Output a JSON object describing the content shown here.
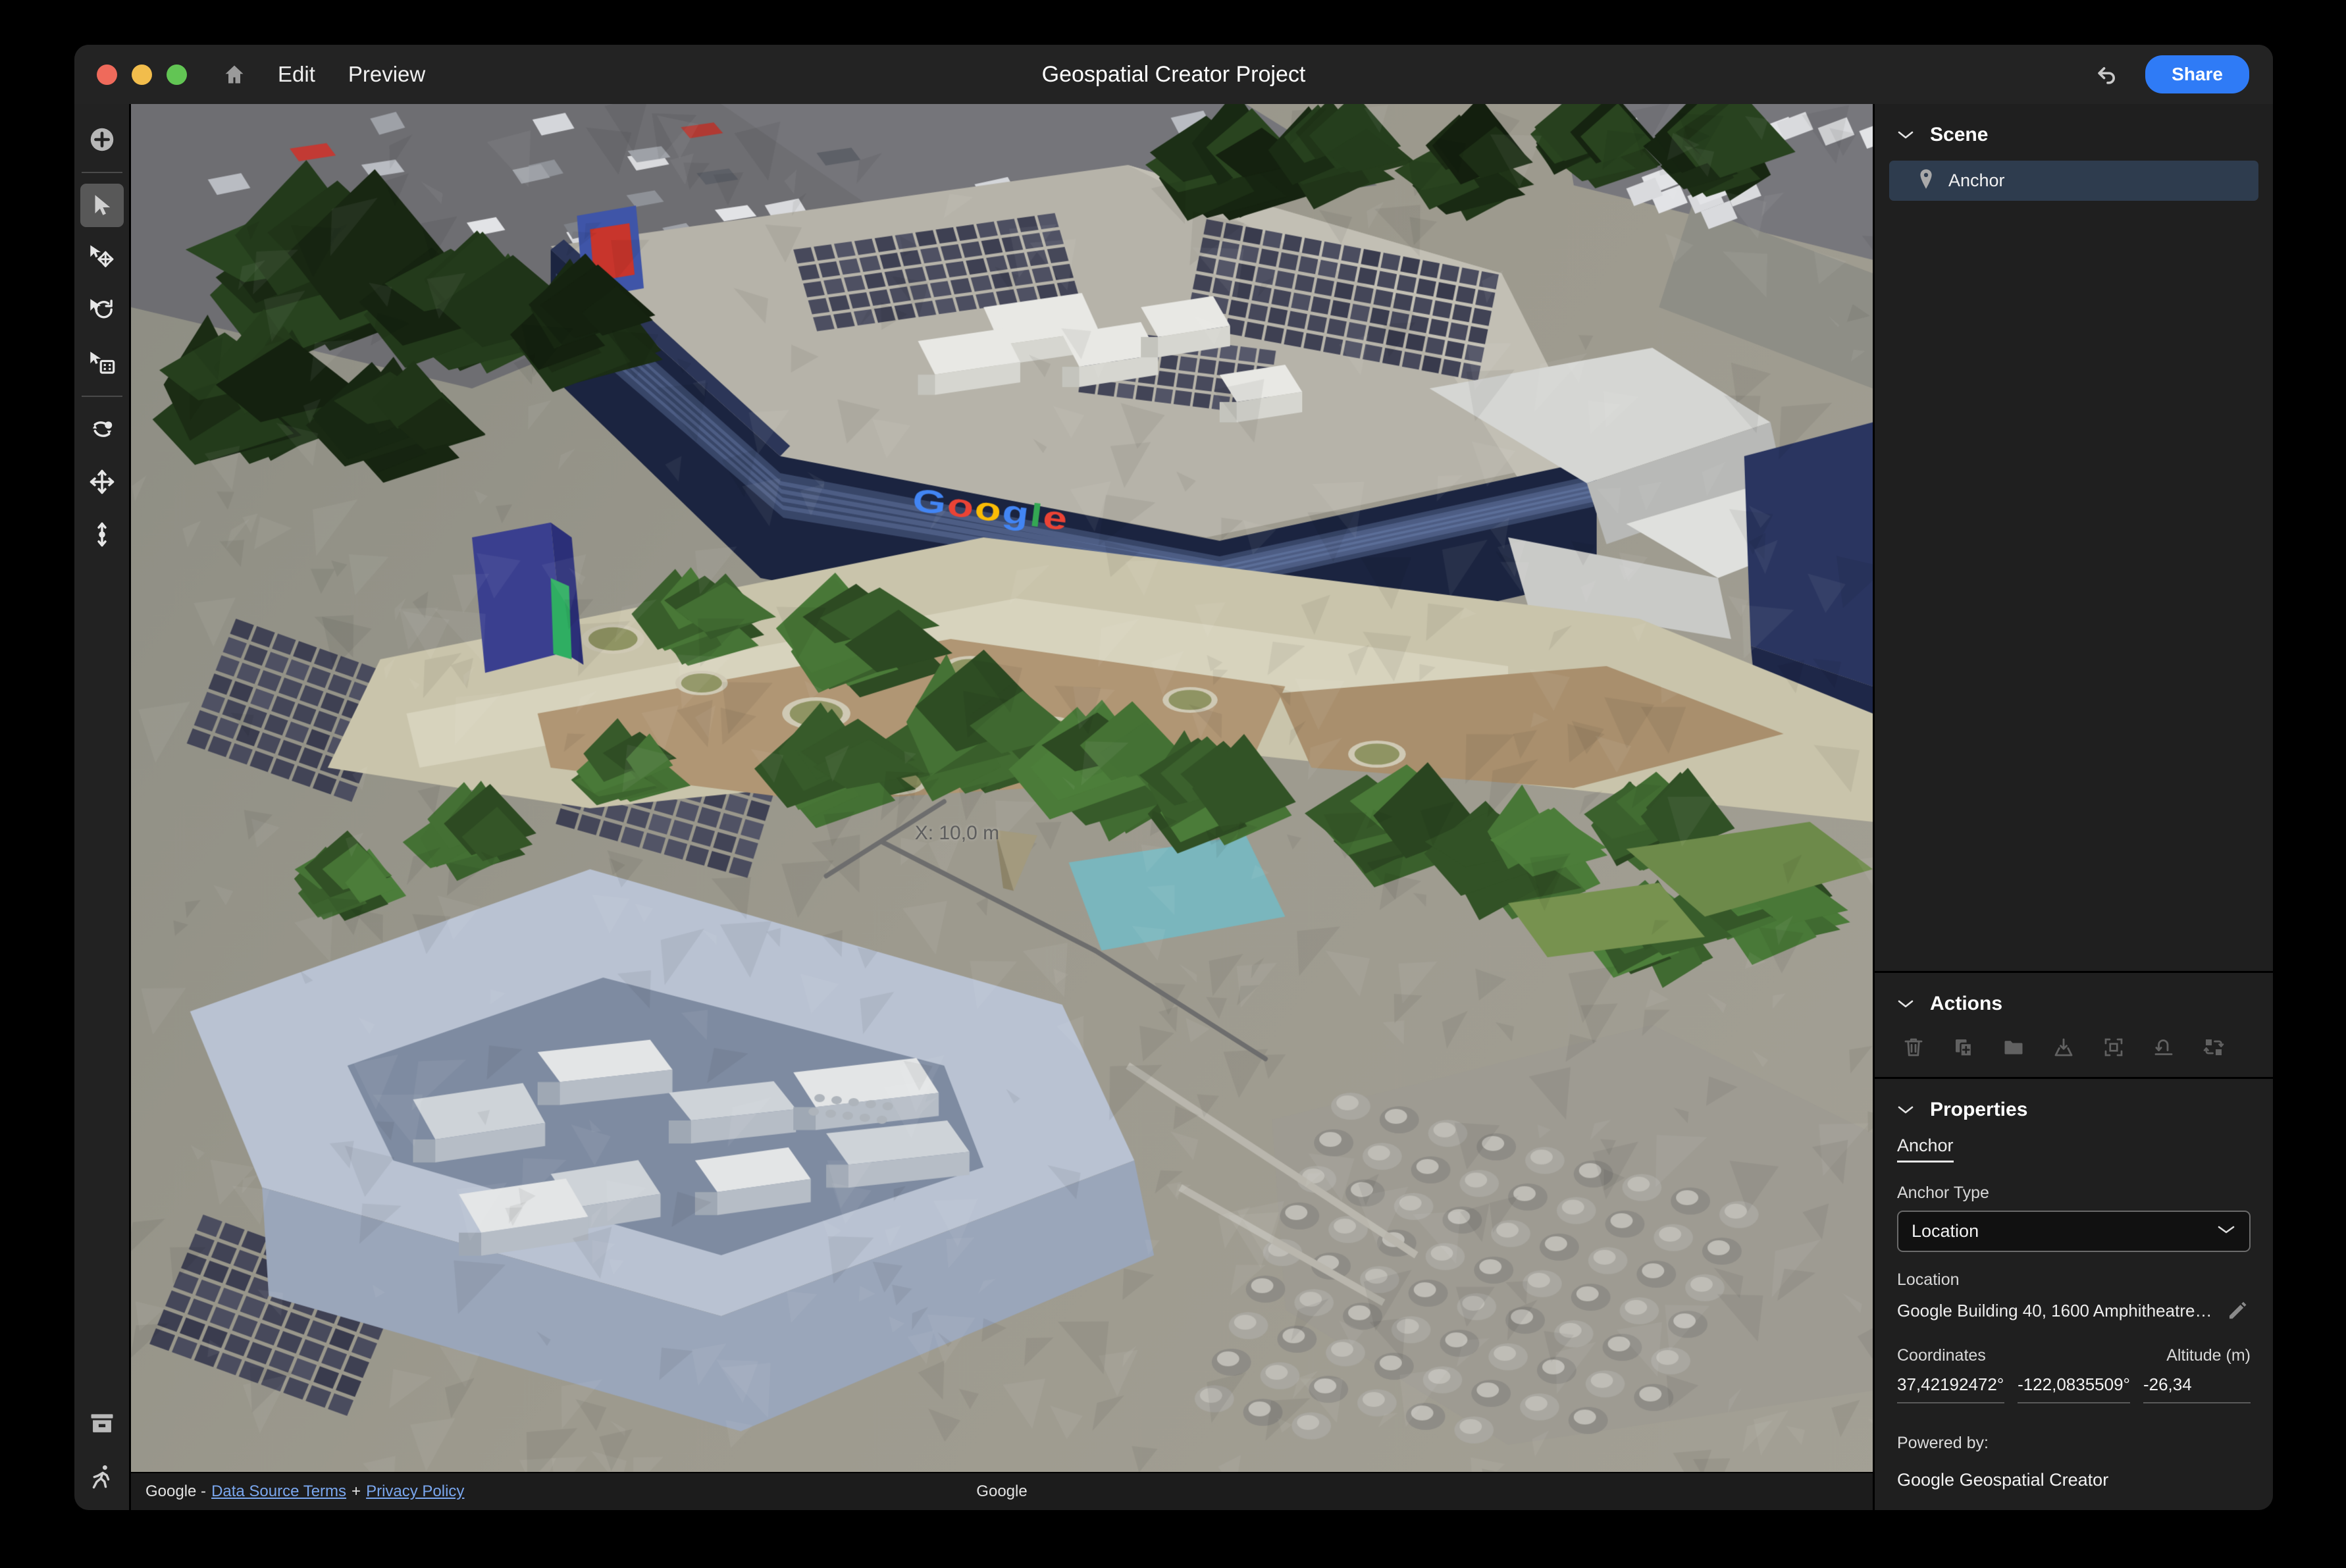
{
  "window": {
    "title": "Geospatial Creator Project",
    "traffic_lights": [
      "close",
      "minimize",
      "maximize"
    ],
    "menus": [
      "Edit",
      "Preview"
    ],
    "home_icon": "home-icon",
    "undo_icon": "undo-arrow-icon",
    "share_label": "Share",
    "share_color": "#2f7bf6"
  },
  "left_toolbar": {
    "tools": [
      {
        "name": "add-object-tool",
        "icon": "plus-circle-icon",
        "active": false
      },
      {
        "name": "select-tool",
        "icon": "cursor-arrow-icon",
        "active": true
      },
      {
        "name": "move-tool",
        "icon": "cursor-move-icon",
        "active": false
      },
      {
        "name": "rotate-tool",
        "icon": "cursor-rotate-icon",
        "active": false
      },
      {
        "name": "scale-tool",
        "icon": "cursor-scale-icon",
        "active": false
      },
      {
        "name": "orbit-tool",
        "icon": "orbit-icon",
        "active": false
      },
      {
        "name": "pan-tool",
        "icon": "pan-arrows-icon",
        "active": false
      },
      {
        "name": "elevate-tool",
        "icon": "vertical-move-icon",
        "active": false
      }
    ],
    "bottom_tools": [
      {
        "name": "archive-tool",
        "icon": "archive-box-icon"
      },
      {
        "name": "walk-mode-tool",
        "icon": "running-person-icon"
      }
    ]
  },
  "viewport": {
    "measurement_label": "X: 10,0 m",
    "scene_description": "Aerial 3D photogrammetry view of Google Building 40, Mountain View"
  },
  "statusbar": {
    "provider": "Google -",
    "data_source_terms": "Data Source Terms",
    "plus": "+",
    "privacy_policy": "Privacy Policy",
    "attribution": "Google"
  },
  "scene": {
    "title": "Scene",
    "chevron": "chevron-down-icon",
    "items": [
      {
        "label": "Anchor",
        "icon": "map-pin-icon",
        "selected": true
      }
    ]
  },
  "actions": {
    "title": "Actions",
    "chevron": "chevron-down-icon",
    "buttons": [
      {
        "name": "delete-action",
        "icon": "trash-icon"
      },
      {
        "name": "duplicate-action",
        "icon": "duplicate-icon"
      },
      {
        "name": "group-action",
        "icon": "folder-icon"
      },
      {
        "name": "place-on-ground-action",
        "icon": "place-down-icon"
      },
      {
        "name": "frame-selection-action",
        "icon": "frame-crop-icon"
      },
      {
        "name": "reset-action",
        "icon": "undo-curve-icon"
      },
      {
        "name": "replace-action",
        "icon": "swap-icon"
      }
    ]
  },
  "properties": {
    "title": "Properties",
    "chevron": "chevron-down-icon",
    "tabs": [
      {
        "label": "Anchor",
        "active": true
      }
    ],
    "anchor_type_label": "Anchor Type",
    "anchor_type_value": "Location",
    "anchor_type_options": [
      "Location"
    ],
    "location_label": "Location",
    "location_value": "Google Building 40, 1600 Amphitheatre P…",
    "edit_icon": "pencil-icon",
    "coordinates_label": "Coordinates",
    "altitude_label": "Altitude (m)",
    "latitude": "37,42192472°",
    "longitude": "-122,0835509°",
    "altitude": "-26,34",
    "powered_by_label": "Powered by:",
    "powered_by_value": "Google Geospatial Creator"
  }
}
